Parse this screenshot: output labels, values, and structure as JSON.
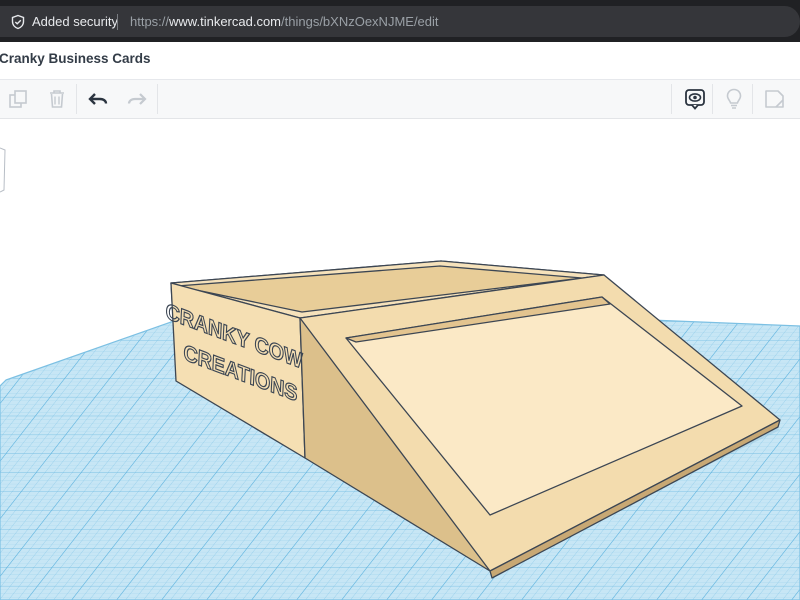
{
  "browser": {
    "security_label": "Added security",
    "url_scheme": "https://",
    "url_host": "www.tinkercad.com",
    "url_path": "/things/bXNzOexNJME/edit"
  },
  "app": {
    "title": "Cranky Business Cards"
  },
  "toolbar": {
    "icons": [
      "copy-icon",
      "trash-icon",
      "undo-icon",
      "redo-icon",
      "show-all-icon",
      "light-bulb-icon",
      "note-icon"
    ]
  },
  "model": {
    "embossed_text_line1": "CRANKY COW",
    "embossed_text_line2": "CREATIONS"
  },
  "colors": {
    "workplane": "#bfe2f3",
    "grid_line": "#7dc3e6",
    "model_light": "#f6deb1",
    "model_mid": "#e9cf9e",
    "model_dark": "#d8b982",
    "outline": "#3c4653"
  }
}
